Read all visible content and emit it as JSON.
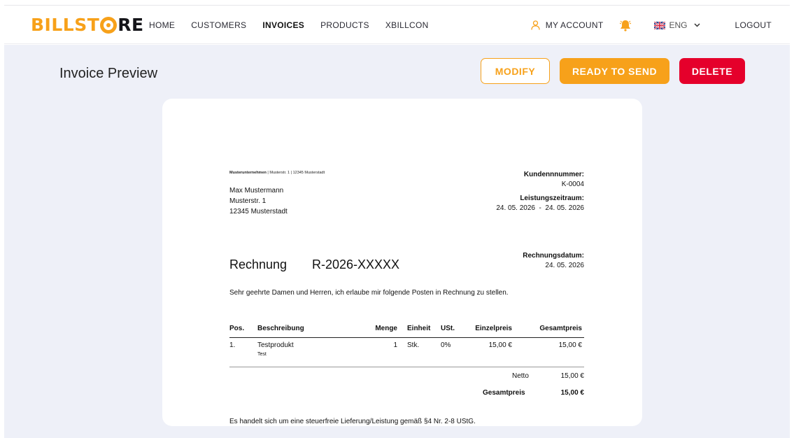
{
  "app": {
    "logo_left": "BILLST",
    "logo_right": "RE",
    "brand_color": "#f7a11a"
  },
  "nav": {
    "items": [
      {
        "label": "HOME"
      },
      {
        "label": "CUSTOMERS"
      },
      {
        "label": "INVOICES",
        "active": true
      },
      {
        "label": "PRODUCTS"
      },
      {
        "label": "XBILLCON"
      }
    ],
    "account_label": "MY ACCOUNT",
    "language": "ENG",
    "logout_label": "LOGOUT",
    "icons": [
      "user-icon",
      "bell-icon",
      "uk-flag-icon",
      "chevron-down-icon"
    ]
  },
  "page": {
    "title": "Invoice Preview",
    "actions": {
      "modify": "MODIFY",
      "ready": "READY TO SEND",
      "delete": "DELETE"
    },
    "colors": {
      "primary": "#f7a11a",
      "danger": "#e5002b",
      "background": "#eef0f8"
    }
  },
  "invoice": {
    "sender_company": "Musterunternehmen",
    "sender_address": " | Musterstr. 1 | 12345 Musterstadt",
    "recipient": {
      "name": "Max Mustermann",
      "street": "Musterstr. 1",
      "city": "12345 Musterstadt"
    },
    "customer_number_label": "Kundennnummer:",
    "customer_number": "K-0004",
    "service_period_label": "Leistungszeitraum:",
    "service_period": "24. 05. 2026  -  24. 05. 2026",
    "title": "Rechnung",
    "number": "R-2026-XXXXX",
    "date_label": "Rechnungsdatum:",
    "date": "24. 05. 2026",
    "intro": "Sehr geehrte Damen und Herren, ich erlaube mir folgende Posten in Rechnung zu stellen.",
    "columns": {
      "pos": "Pos.",
      "desc": "Beschreibung",
      "qty": "Menge",
      "unit": "Einheit",
      "vat": "USt.",
      "unit_price": "Einzelpreis",
      "total": "Gesamtpreis"
    },
    "items": [
      {
        "pos": "1.",
        "desc": "Testprodukt",
        "sub": "Test",
        "qty": "1",
        "unit": "Stk.",
        "vat": "0%",
        "unit_price": "15,00 €",
        "total": "15,00 €"
      }
    ],
    "netto_label": "Netto",
    "netto": "15,00 €",
    "grand_total_label": "Gesamtpreis",
    "grand_total": "15,00 €",
    "footer_note": "Es handelt sich um eine steuerfreie Lieferung/Leistung gemäß §4 Nr. 2-8 UStG."
  }
}
